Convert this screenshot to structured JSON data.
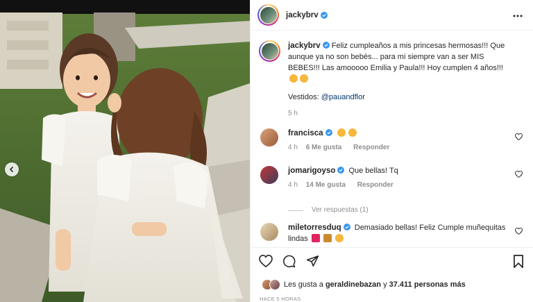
{
  "post": {
    "author": "jackybrv",
    "caption_text": "Feliz cumpleaños a mis princesas hermosas!!! Que aunque ya no son bebés... para mi siempre van a ser MIS BEBES!!! Las amooooo Emilia y Paula!!! Hoy cumplen 4 años!!!",
    "vestidos_label": "Vestidos:",
    "vestidos_mention": "@pauandflor",
    "caption_time": "5 h"
  },
  "comments": [
    {
      "user": "francisca",
      "verified": true,
      "text": "",
      "emojis": [
        "heart-eyes",
        "heart-eyes"
      ],
      "time": "4 h",
      "likes": "6 Me gusta",
      "reply": "Responder"
    },
    {
      "user": "jomarigoyso",
      "verified": true,
      "text": "Que bellas! Tq",
      "time": "4 h",
      "likes": "14 Me gusta",
      "reply": "Responder",
      "view_replies": "Ver respuestas (1)"
    },
    {
      "user": "miletorresduq",
      "verified": true,
      "text": "Demasiado bellas! Feliz Cumple muñequitas lindas"
    }
  ],
  "likes": {
    "prefix": "Les gusta a",
    "user": "geraldinebazan",
    "middle": "y",
    "count": "37.411 personas más"
  },
  "timestamp": "HACE 5 HORAS",
  "colors": {
    "verified": "#3897f0",
    "link": "#00376b",
    "meta": "#8e8e8e"
  },
  "icons": [
    "more-icon",
    "heart-icon",
    "comment-icon",
    "share-icon",
    "bookmark-icon",
    "verified-icon",
    "chevron-left-icon"
  ]
}
